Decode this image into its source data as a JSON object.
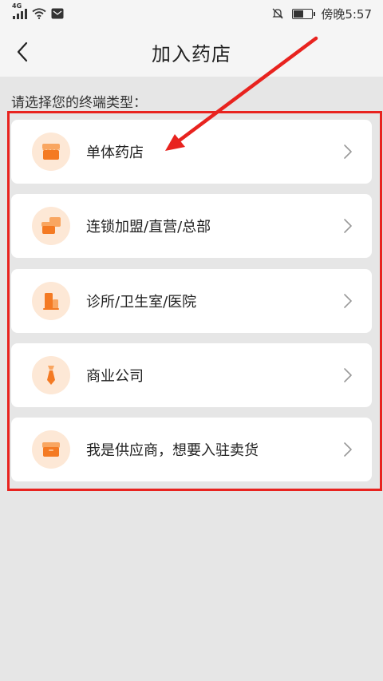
{
  "status_bar": {
    "network": "4G",
    "time": "傍晚5:57"
  },
  "header": {
    "title": "加入药店"
  },
  "prompt": "请选择您的终端类型：",
  "options": [
    {
      "label": "单体药店",
      "icon": "store-icon"
    },
    {
      "label": "连锁加盟/直营/总部",
      "icon": "chain-store-icon"
    },
    {
      "label": "诊所/卫生室/医院",
      "icon": "clinic-building-icon"
    },
    {
      "label": "商业公司",
      "icon": "tie-icon"
    },
    {
      "label": "我是供应商，想要入驻卖货",
      "icon": "box-icon"
    }
  ],
  "colors": {
    "accent": "#f47a23",
    "icon_bg": "#fde8d6",
    "annotation_red": "#e8231f",
    "page_bg": "#e6e6e6"
  }
}
